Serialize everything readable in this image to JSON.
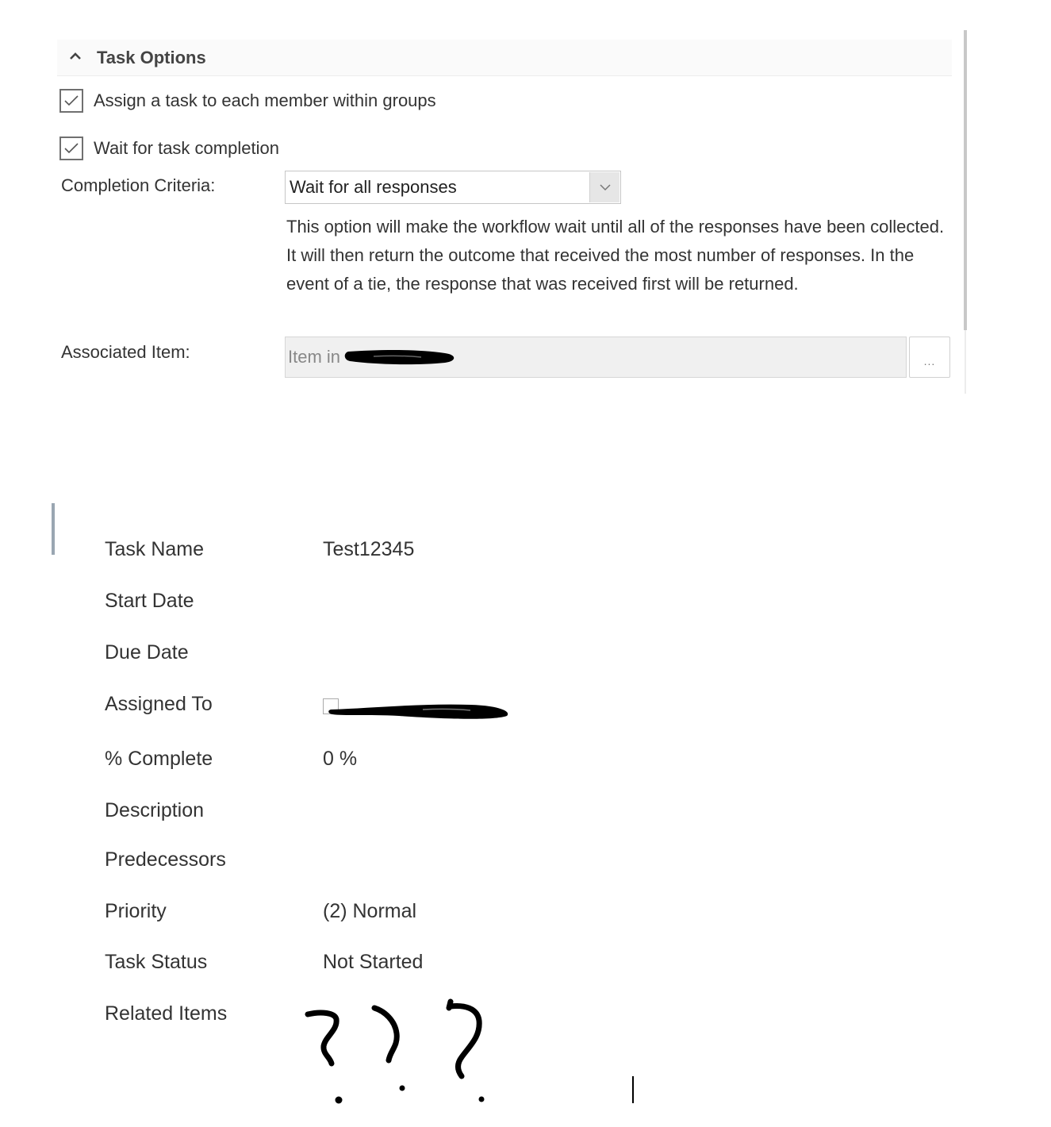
{
  "task_options": {
    "section_title": "Task Options",
    "section_expanded": true,
    "assign_each_member": {
      "label": "Assign a task to each member within groups",
      "checked": true
    },
    "wait_for_completion": {
      "label": "Wait for task completion",
      "checked": true
    },
    "completion_criteria": {
      "label": "Completion Criteria:",
      "selected": "Wait for all responses",
      "help_text": "This option will make the workflow wait until all of the responses have been collected. It will then return the outcome that received the most number of responses. In the event of a tie, the response that was received first will be returned."
    },
    "associated_item": {
      "label": "Associated Item:",
      "value_prefix": "Item in",
      "value_redacted": true,
      "browse_label": "..."
    }
  },
  "task_details": {
    "fields": [
      {
        "label": "Task Name",
        "value": "Test12345"
      },
      {
        "label": "Start Date",
        "value": ""
      },
      {
        "label": "Due Date",
        "value": ""
      },
      {
        "label": "Assigned To",
        "value": "",
        "redacted": true
      },
      {
        "label": "% Complete",
        "value": "0 %"
      },
      {
        "label": "Description",
        "value": ""
      },
      {
        "label": "Predecessors",
        "value": ""
      },
      {
        "label": "Priority",
        "value": "(2) Normal"
      },
      {
        "label": "Task Status",
        "value": "Not Started"
      },
      {
        "label": "Related Items",
        "value": "???",
        "annotation": "hand-drawn question marks"
      }
    ]
  },
  "icons": {
    "section_toggle": "chevron-up-icon",
    "checkbox_mark": "checkmark-icon",
    "dropdown": "chevron-down-icon"
  }
}
